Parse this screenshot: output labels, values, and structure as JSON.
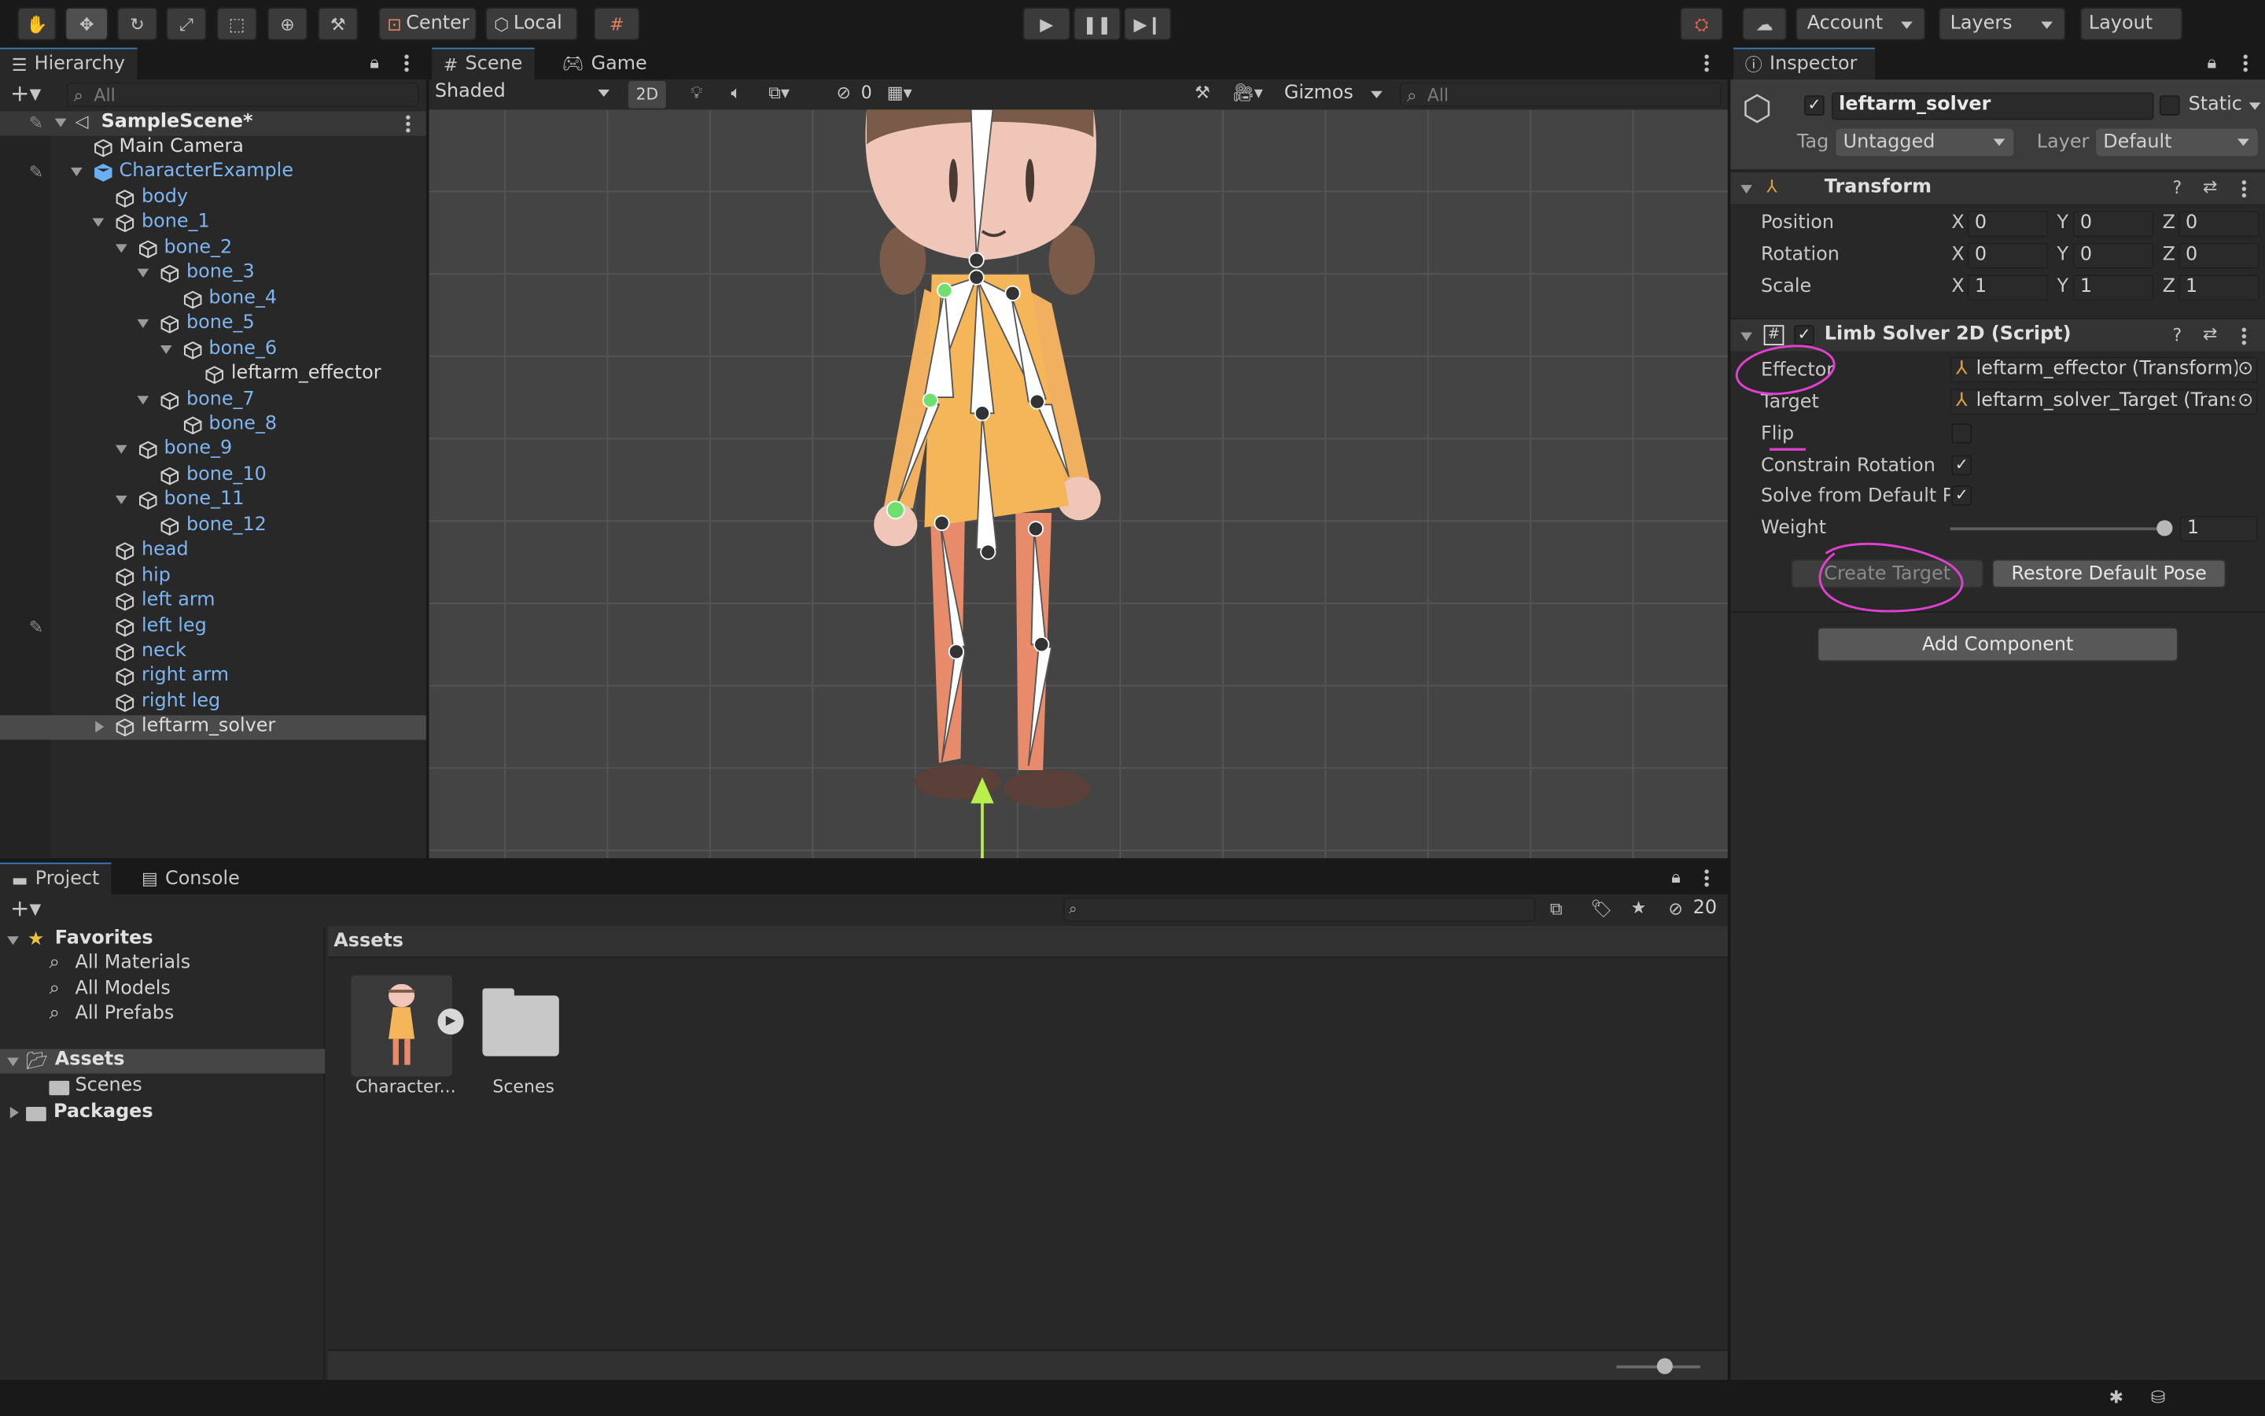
{
  "toolbar": {
    "center_label": "Center",
    "local_label": "Local",
    "account_label": "Account",
    "layers_label": "Layers",
    "layout_label": "Layout"
  },
  "hierarchy": {
    "tab": "Hierarchy",
    "search_placeholder": "All",
    "scene": "SampleScene*",
    "items": [
      "Main Camera",
      "CharacterExample",
      "body",
      "bone_1",
      "bone_2",
      "bone_3",
      "bone_4",
      "bone_5",
      "bone_6",
      "leftarm_effector",
      "bone_7",
      "bone_8",
      "bone_9",
      "bone_10",
      "bone_11",
      "bone_12",
      "head",
      "hip",
      "left arm",
      "left leg",
      "neck",
      "right arm",
      "right leg",
      "leftarm_solver"
    ]
  },
  "scene_view": {
    "tabs": [
      "Scene",
      "Game"
    ],
    "shading": "Shaded",
    "mode_2d": "2D",
    "hidden_count": "0",
    "gizmos": "Gizmos",
    "search_placeholder": "All"
  },
  "inspector": {
    "tab": "Inspector",
    "object_name": "leftarm_solver",
    "static_label": "Static",
    "tag_label": "Tag",
    "tag_value": "Untagged",
    "layer_label": "Layer",
    "layer_value": "Default",
    "transform": {
      "title": "Transform",
      "position_label": "Position",
      "rotation_label": "Rotation",
      "scale_label": "Scale",
      "axis_x": "X",
      "axis_y": "Y",
      "axis_z": "Z",
      "position": [
        "0",
        "0",
        "0"
      ],
      "rotation": [
        "0",
        "0",
        "0"
      ],
      "scale": [
        "1",
        "1",
        "1"
      ]
    },
    "limb_solver": {
      "title": "Limb Solver 2D (Script)",
      "effector_label": "Effector",
      "effector_value": "leftarm_effector (Transform)",
      "target_label": "Target",
      "target_value": "leftarm_solver_Target (Transf",
      "flip_label": "Flip",
      "flip": false,
      "constrain_label": "Constrain Rotation",
      "constrain": true,
      "solve_label": "Solve from Default Po",
      "solve": true,
      "weight_label": "Weight",
      "weight": "1",
      "create_target": "Create Target",
      "restore_pose": "Restore Default Pose"
    },
    "add_component": "Add Component"
  },
  "project": {
    "tabs": [
      "Project",
      "Console"
    ],
    "hidden_count": "20",
    "favorites_label": "Favorites",
    "favorites": [
      "All Materials",
      "All Models",
      "All Prefabs"
    ],
    "assets_label": "Assets",
    "assets_children": [
      "Scenes"
    ],
    "packages_label": "Packages",
    "breadcrumb": "Assets",
    "assets": [
      {
        "name": "Character..."
      },
      {
        "name": "Scenes"
      }
    ]
  },
  "colors": {
    "accent": "#3a79bb",
    "selection": "#2c5d87",
    "annotation": "#e040d0",
    "text_link": "#7eb5f0"
  }
}
